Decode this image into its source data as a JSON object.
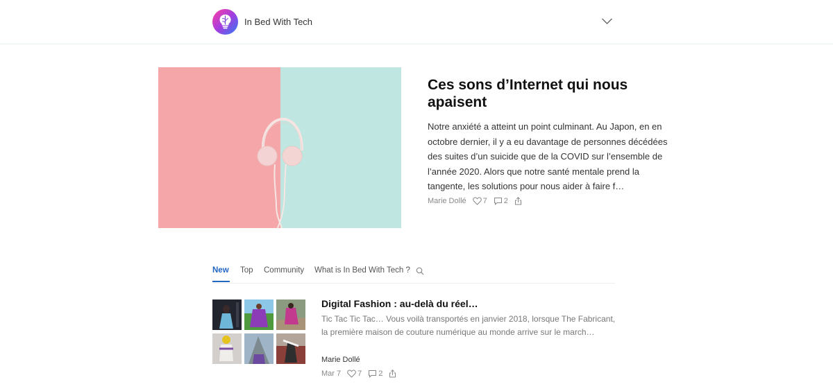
{
  "header": {
    "brand": "In Bed With Tech",
    "logo_icon": "lightbulb-brain-icon",
    "menu_icon": "chevron-down-icon"
  },
  "featured": {
    "title": "Ces sons d’Internet qui nous apaisent",
    "excerpt": "Notre anxiété a atteint un point culminant. Au Japon, en en octobre dernier, il y a eu davantage de personnes décédées des suites d’un suicide que de la COVID sur l’ensemble de l’année 2020. Alors que notre santé mentale prend la tangente, les solutions pour nous aider à faire f…",
    "author": "Marie Dollé",
    "likes": "7",
    "comments": "2",
    "image": "headphones-on-pink-teal-background"
  },
  "tabs": {
    "items": [
      {
        "label": "New",
        "active": true
      },
      {
        "label": "Top"
      },
      {
        "label": "Community"
      },
      {
        "label": "What is In Bed With Tech ?"
      }
    ],
    "search_icon": "search-icon"
  },
  "post": {
    "title": "Digital Fashion : au-delà du réel…",
    "excerpt": "Tic Tac Tic Tac… Vous voilà transportés en janvier 2018, lorsque The Fabricant, la première maison de couture numérique au monde arrive sur le march…",
    "author": "Marie Dollé",
    "date": "Mar 7",
    "likes": "7",
    "comments": "2"
  },
  "colors": {
    "accent": "#2266c4",
    "hero_pink": "#f4a6a8",
    "hero_teal": "#bfe6e0"
  }
}
